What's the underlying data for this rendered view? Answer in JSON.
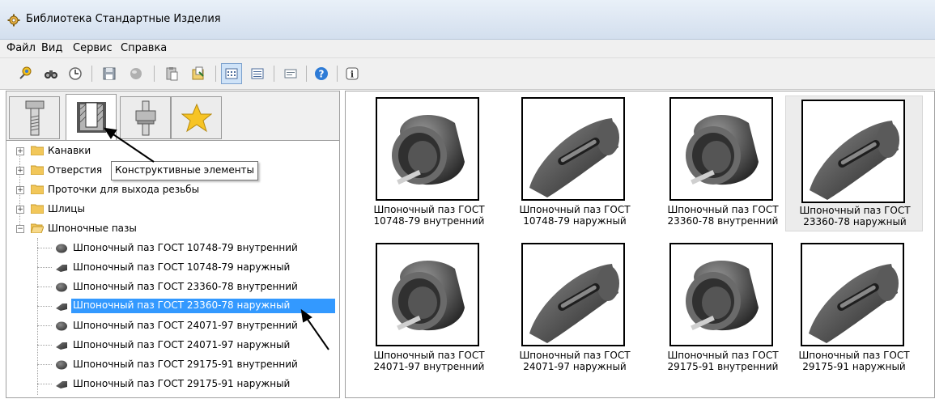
{
  "window": {
    "title": "Библиотека Стандартные Изделия",
    "icon": "gear-icon"
  },
  "menu": [
    "Файл",
    "Вид",
    "Сервис",
    "Справка"
  ],
  "toolbar": {
    "buttons": [
      "pin-icon",
      "binoculars-icon",
      "clock-icon",
      "save-icon",
      "sphere-icon",
      "paste-icon",
      "export-icon",
      "large-icons-view-icon",
      "list-view-icon",
      "details-view-icon",
      "help-icon",
      "info-icon"
    ],
    "active": "large-icons-view-icon"
  },
  "tabs": [
    "bolt-icon",
    "structural-element-icon",
    "nut-icon",
    "star-icon"
  ],
  "tooltip": "Конструктивные элементы",
  "tree": {
    "folders": [
      "Канавки",
      "Отверстия",
      "Проточки для выхода резьбы",
      "Шлицы",
      "Шпоночные пазы"
    ],
    "items": [
      "Шпоночный паз ГОСТ 10748-79 внутренний",
      "Шпоночный паз ГОСТ 10748-79 наружный",
      "Шпоночный паз ГОСТ 23360-78 внутренний",
      "Шпоночный паз ГОСТ 23360-78 наружный",
      "Шпоночный паз ГОСТ 24071-97 внутренний",
      "Шпоночный паз ГОСТ 24071-97 наружный",
      "Шпоночный паз ГОСТ 29175-91 внутренний",
      "Шпоночный паз ГОСТ 29175-91 наружный"
    ],
    "selected_item": "Шпоночный паз ГОСТ 23360-78 наружный"
  },
  "gallery": [
    {
      "line1": "Шпоночный паз ГОСТ",
      "line2": "10748-79 внутренний",
      "kind": "inner"
    },
    {
      "line1": "Шпоночный паз ГОСТ",
      "line2": "10748-79 наружный",
      "kind": "outer"
    },
    {
      "line1": "Шпоночный паз ГОСТ",
      "line2": "23360-78 внутренний",
      "kind": "inner"
    },
    {
      "line1": "Шпоночный паз ГОСТ",
      "line2": "23360-78 наружный",
      "kind": "outer"
    },
    {
      "line1": "Шпоночный паз ГОСТ",
      "line2": "24071-97 внутренний",
      "kind": "inner"
    },
    {
      "line1": "Шпоночный паз ГОСТ",
      "line2": "24071-97 наружный",
      "kind": "outer"
    },
    {
      "line1": "Шпоночный паз ГОСТ",
      "line2": "29175-91 внутренний",
      "kind": "inner"
    },
    {
      "line1": "Шпоночный паз ГОСТ",
      "line2": "29175-91 наружный",
      "kind": "outer"
    }
  ],
  "colors": {
    "selection": "#3399ff",
    "card_selected": "#ececec"
  }
}
